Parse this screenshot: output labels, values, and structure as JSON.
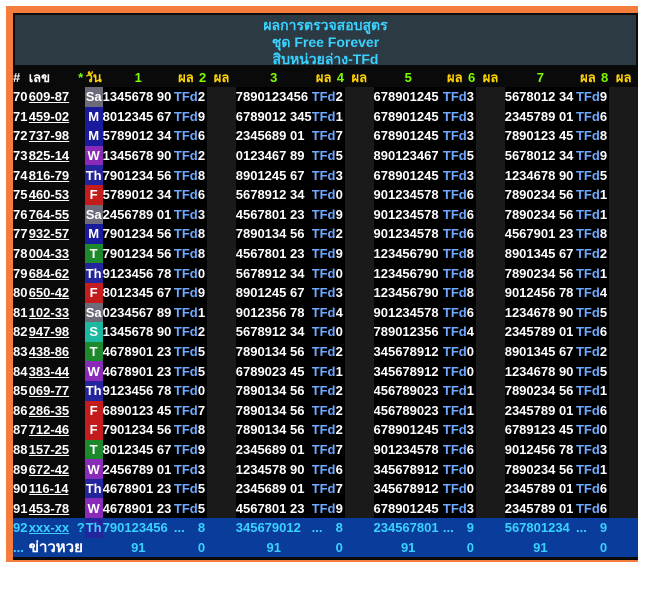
{
  "title": {
    "line1": "ผลการตรวจสอบสูตร",
    "line2": "ชุด Free Forever",
    "line3": "สิบหน่วยล่าง-TFd"
  },
  "header": {
    "no": "#",
    "num": "เลข",
    "star": "*",
    "day": "วัน",
    "cols": [
      "1",
      "ผล",
      "2",
      "ผล",
      "3",
      "ผล",
      "4",
      "ผล",
      "5",
      "ผล",
      "6",
      "ผล",
      "7",
      "ผล",
      "8",
      "ผล"
    ]
  },
  "day_colors": {
    "Sa": "#6b6b7a",
    "M": "#1a1a9c",
    "Tu": "#d42a9c",
    "W": "#8a2ab8",
    "Th": "#24249c",
    "F": "#c41c1c",
    "S": "#1cb8a0",
    "T": "#1c8a2c"
  },
  "rows": [
    {
      "no": "70",
      "num": "609-87",
      "day": "Sa",
      "sets": [
        "1345678 90",
        "7890123456",
        "678901245",
        "5678012 34"
      ],
      "res": [
        "TFd",
        "TFd",
        "TFd",
        "TFd"
      ],
      "dig": [
        "2",
        "2",
        "3",
        "9"
      ]
    },
    {
      "no": "71",
      "num": "459-02",
      "day": "M",
      "sets": [
        "8012345 67",
        "6789012 345",
        "678901245",
        "2345789 01"
      ],
      "res": [
        "TFd",
        "TFd",
        "TFd",
        "TFd"
      ],
      "dig": [
        "9",
        "1",
        "3",
        "6"
      ]
    },
    {
      "no": "72",
      "num": "737-98",
      "day": "M",
      "sets": [
        "5789012 34",
        "2345689 01",
        "678901245",
        "7890123 45"
      ],
      "res": [
        "TFd",
        "TFd",
        "TFd",
        "TFd"
      ],
      "dig": [
        "6",
        "7",
        "3",
        "8"
      ]
    },
    {
      "no": "73",
      "num": "825-14",
      "day": "W",
      "sets": [
        "1345678 90",
        "0123467 89",
        "890123467",
        "5678012 34"
      ],
      "res": [
        "TFd",
        "TFd",
        "TFd",
        "TFd"
      ],
      "dig": [
        "2",
        "5",
        "5",
        "9"
      ]
    },
    {
      "no": "74",
      "num": "816-79",
      "day": "Th",
      "sets": [
        "7901234 56",
        "8901245 67",
        "678901245",
        "1234678 90"
      ],
      "res": [
        "TFd",
        "TFd",
        "TFd",
        "TFd"
      ],
      "dig": [
        "8",
        "3",
        "3",
        "5"
      ]
    },
    {
      "no": "75",
      "num": "460-53",
      "day": "F",
      "sets": [
        "5789012 34",
        "5678912 34",
        "901234578",
        "7890234 56"
      ],
      "res": [
        "TFd",
        "TFd",
        "TFd",
        "TFd"
      ],
      "dig": [
        "6",
        "0",
        "6",
        "1"
      ]
    },
    {
      "no": "76",
      "num": "764-55",
      "day": "Sa",
      "sets": [
        "2456789 01",
        "4567801 23",
        "901234578",
        "7890234 56"
      ],
      "res": [
        "TFd",
        "TFd",
        "TFd",
        "TFd"
      ],
      "dig": [
        "3",
        "9",
        "6",
        "1"
      ]
    },
    {
      "no": "77",
      "num": "932-57",
      "day": "M",
      "sets": [
        "7901234 56",
        "7890134 56",
        "901234578",
        "4567901 23"
      ],
      "res": [
        "TFd",
        "TFd",
        "TFd",
        "TFd"
      ],
      "dig": [
        "8",
        "2",
        "6",
        "8"
      ]
    },
    {
      "no": "78",
      "num": "004-33",
      "day": "T",
      "sets": [
        "7901234 56",
        "4567801 23",
        "123456790",
        "8901345 67"
      ],
      "res": [
        "TFd",
        "TFd",
        "TFd",
        "TFd"
      ],
      "dig": [
        "8",
        "9",
        "8",
        "2"
      ]
    },
    {
      "no": "79",
      "num": "684-62",
      "day": "Th",
      "sets": [
        "9123456 78",
        "5678912 34",
        "123456790",
        "7890234 56"
      ],
      "res": [
        "TFd",
        "TFd",
        "TFd",
        "TFd"
      ],
      "dig": [
        "0",
        "0",
        "8",
        "1"
      ]
    },
    {
      "no": "80",
      "num": "650-42",
      "day": "F",
      "sets": [
        "8012345 67",
        "8901245 67",
        "123456790",
        "9012456 78"
      ],
      "res": [
        "TFd",
        "TFd",
        "TFd",
        "TFd"
      ],
      "dig": [
        "9",
        "3",
        "8",
        "4"
      ]
    },
    {
      "no": "81",
      "num": "102-33",
      "day": "Sa",
      "sets": [
        "0234567 89",
        "9012356 78",
        "901234578",
        "1234678 90"
      ],
      "res": [
        "TFd",
        "TFd",
        "TFd",
        "TFd"
      ],
      "dig": [
        "1",
        "4",
        "6",
        "5"
      ]
    },
    {
      "no": "82",
      "num": "947-98",
      "day": "S",
      "sets": [
        "1345678 90",
        "5678912 34",
        "789012356",
        "2345789 01"
      ],
      "res": [
        "TFd",
        "TFd",
        "TFd",
        "TFd"
      ],
      "dig": [
        "2",
        "0",
        "4",
        "6"
      ]
    },
    {
      "no": "83",
      "num": "438-86",
      "day": "T",
      "sets": [
        "4678901 23",
        "7890134 56",
        "345678912",
        "8901345 67"
      ],
      "res": [
        "TFd",
        "TFd",
        "TFd",
        "TFd"
      ],
      "dig": [
        "5",
        "2",
        "0",
        "2"
      ]
    },
    {
      "no": "84",
      "num": "383-44",
      "day": "W",
      "sets": [
        "4678901 23",
        "6789023 45",
        "345678912",
        "1234678 90"
      ],
      "res": [
        "TFd",
        "TFd",
        "TFd",
        "TFd"
      ],
      "dig": [
        "5",
        "1",
        "0",
        "5"
      ]
    },
    {
      "no": "85",
      "num": "069-77",
      "day": "Th",
      "sets": [
        "9123456 78",
        "7890134 56",
        "456789023",
        "7890234 56"
      ],
      "res": [
        "TFd",
        "TFd",
        "TFd",
        "TFd"
      ],
      "dig": [
        "0",
        "2",
        "1",
        "1"
      ]
    },
    {
      "no": "86",
      "num": "286-35",
      "day": "F",
      "sets": [
        "6890123 45",
        "7890134 56",
        "456789023",
        "2345789 01"
      ],
      "res": [
        "TFd",
        "TFd",
        "TFd",
        "TFd"
      ],
      "dig": [
        "7",
        "2",
        "1",
        "6"
      ]
    },
    {
      "no": "87",
      "num": "712-46",
      "day": "F",
      "sets": [
        "7901234 56",
        "7890134 56",
        "678901245",
        "6789123 45"
      ],
      "res": [
        "TFd",
        "TFd",
        "TFd",
        "TFd"
      ],
      "dig": [
        "8",
        "2",
        "3",
        "0"
      ]
    },
    {
      "no": "88",
      "num": "157-25",
      "day": "T",
      "sets": [
        "8012345 67",
        "2345689 01",
        "901234578",
        "9012456 78"
      ],
      "res": [
        "TFd",
        "TFd",
        "TFd",
        "TFd"
      ],
      "dig": [
        "9",
        "7",
        "6",
        "3"
      ]
    },
    {
      "no": "89",
      "num": "672-42",
      "day": "W",
      "sets": [
        "2456789 01",
        "1234578 90",
        "345678912",
        "7890234 56"
      ],
      "res": [
        "TFd",
        "TFd",
        "TFd",
        "TFd"
      ],
      "dig": [
        "3",
        "6",
        "0",
        "1"
      ]
    },
    {
      "no": "90",
      "num": "116-14",
      "day": "Th",
      "sets": [
        "4678901 23",
        "2345689 01",
        "345678912",
        "2345789 01"
      ],
      "res": [
        "TFd",
        "TFd",
        "TFd",
        "TFd"
      ],
      "dig": [
        "5",
        "7",
        "0",
        "6"
      ]
    },
    {
      "no": "91",
      "num": "453-78",
      "day": "W",
      "sets": [
        "4678901 23",
        "4567801 23",
        "678901245",
        "2345789 01"
      ],
      "res": [
        "TFd",
        "TFd",
        "TFd",
        "TFd"
      ],
      "dig": [
        "5",
        "9",
        "3",
        "6"
      ]
    }
  ],
  "last_row": {
    "no": "92",
    "num": "xxx-xx",
    "star": "?",
    "day": "Th",
    "sets": [
      "790123456",
      "345679012",
      "234567801",
      "567801234"
    ],
    "dots": "...",
    "dig": [
      "8",
      "8",
      "9",
      "9"
    ]
  },
  "footer": {
    "dots": "...",
    "label": "ข่าวหวย",
    "totals": [
      "91",
      "0",
      "91",
      "0",
      "91",
      "0",
      "91",
      "0"
    ]
  }
}
